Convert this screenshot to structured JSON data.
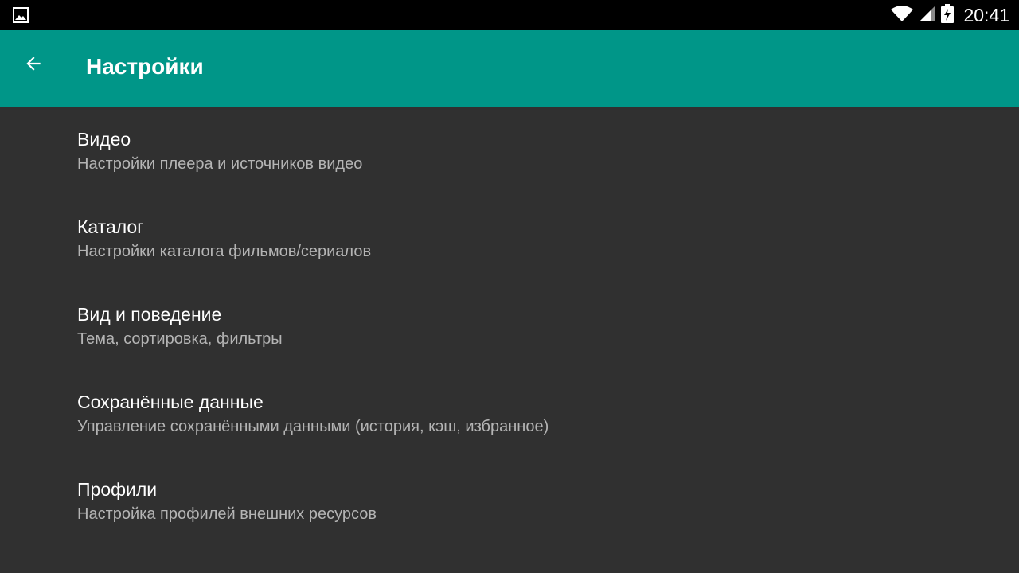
{
  "status_bar": {
    "time": "20:41",
    "icons": [
      "image-notification-icon",
      "wifi-icon",
      "cell-signal-icon",
      "battery-charging-icon"
    ]
  },
  "app_bar": {
    "title": "Настройки",
    "back_icon": "arrow-left-icon",
    "color": "#009688"
  },
  "colors": {
    "background": "#303030",
    "title_text": "#ffffff",
    "summary_text": "#b4b4b4"
  },
  "preferences": [
    {
      "title": "Видео",
      "summary": "Настройки плеера и источников видео"
    },
    {
      "title": "Каталог",
      "summary": "Настройки каталога фильмов/сериалов"
    },
    {
      "title": "Вид и поведение",
      "summary": "Тема, сортировка, фильтры"
    },
    {
      "title": "Сохранённые данные",
      "summary": "Управление сохранёнными данными (история, кэш, избранное)"
    },
    {
      "title": "Профили",
      "summary": "Настройка профилей внешних ресурсов"
    }
  ]
}
